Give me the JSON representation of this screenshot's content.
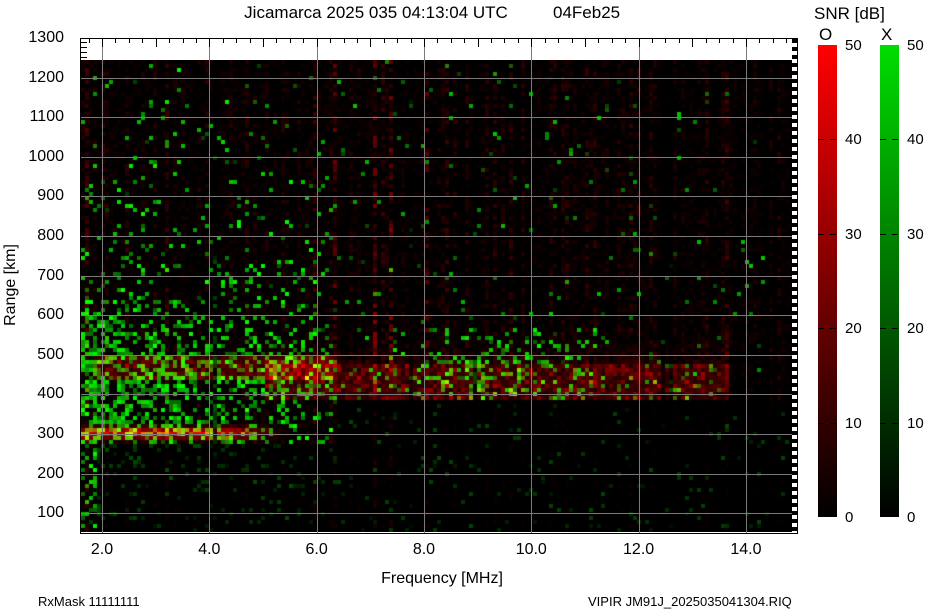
{
  "title": {
    "main": "Jicamarca 2025 035 04:13:04 UTC",
    "date": "04Feb25"
  },
  "footer": {
    "left": "RxMask 11111111",
    "right": "VIPIR  JM91J_2025035041304.RIQ"
  },
  "axes": {
    "x_label": "Frequency [MHz]",
    "y_label": "Range [km]",
    "x_ticks": [
      {
        "label": "2.0",
        "mhz": 2.0
      },
      {
        "label": "4.0",
        "mhz": 4.0
      },
      {
        "label": "6.0",
        "mhz": 6.0
      },
      {
        "label": "8.0",
        "mhz": 8.0
      },
      {
        "label": "10.0",
        "mhz": 10.0
      },
      {
        "label": "12.0",
        "mhz": 12.0
      },
      {
        "label": "14.0",
        "mhz": 14.0
      }
    ],
    "y_ticks": [
      {
        "label": "1300",
        "km": 1300
      },
      {
        "label": "1200",
        "km": 1200
      },
      {
        "label": "1100",
        "km": 1100
      },
      {
        "label": "1000",
        "km": 1000
      },
      {
        "label": "900",
        "km": 900
      },
      {
        "label": "800",
        "km": 800
      },
      {
        "label": "700",
        "km": 700
      },
      {
        "label": "600",
        "km": 600
      },
      {
        "label": "500",
        "km": 500
      },
      {
        "label": "400",
        "km": 400
      },
      {
        "label": "300",
        "km": 300
      },
      {
        "label": "200",
        "km": 200
      },
      {
        "label": "100",
        "km": 100
      }
    ]
  },
  "colorbar": {
    "title": "SNR [dB]",
    "range": [
      0,
      50
    ],
    "ticks": [
      {
        "label": "50",
        "value": 50
      },
      {
        "label": "40",
        "value": 40
      },
      {
        "label": "30",
        "value": 30
      },
      {
        "label": "20",
        "value": 20
      },
      {
        "label": "10",
        "value": 10
      },
      {
        "label": "0",
        "value": 0
      }
    ],
    "bars": [
      {
        "label": "O",
        "top_color": "#ff0000",
        "bottom_color": "#000000"
      },
      {
        "label": "X",
        "top_color": "#00dd00",
        "bottom_color": "#000000"
      }
    ]
  },
  "chart_data": {
    "type": "heatmap",
    "title": "Jicamarca ionogram, day 2025-035 04:13:04 UTC (04Feb25)",
    "xlabel": "Frequency [MHz]",
    "ylabel": "Range [km]",
    "x_range_mhz": [
      1.6,
      15.0
    ],
    "y_range_km": [
      50,
      1300
    ],
    "max_data_range_km": 1244,
    "grid": true,
    "background": "#000000",
    "value_label": "SNR [dB]",
    "value_range_db": [
      0,
      50
    ],
    "polarizations": {
      "O_mode_color": "red",
      "X_mode_color": "green"
    },
    "features": [
      {
        "id": "o_trace",
        "desc": "saturated O-mode F-layer bottom trace ~300 km",
        "kind": "trace",
        "f_mhz": [
          1.61,
          5.4
        ],
        "fade_from_mhz": 4.4,
        "center_km": 300,
        "width_km": 14,
        "peak": 255
      },
      {
        "id": "red_layer2",
        "desc": "second red echo layer 435-495 km at low freq",
        "kind": "band",
        "f_mhz": [
          1.8,
          6.3
        ],
        "range_km": [
          435,
          495
        ],
        "amp": 150
      },
      {
        "id": "spread_band",
        "desc": "spread-F red band 390-470 km, 5-13.7 MHz, 15-35 dB",
        "kind": "band",
        "f_mhz": [
          5.0,
          13.7
        ],
        "range_km": [
          388,
          472
        ],
        "amp": 170,
        "green_speck_density": 0.07
      },
      {
        "id": "green_cloud",
        "desc": "dense green X-mode coherent scatter cloud at low frequencies",
        "kind": "cloud",
        "f_mhz": [
          1.61,
          6.3
        ],
        "center_km": 430,
        "sigma_km": 170,
        "density": 0.5
      },
      {
        "id": "left_edge_green",
        "desc": "green column hugging low-frequency edge",
        "kind": "column",
        "f_mhz": [
          1.61,
          2.0
        ],
        "range_km": [
          80,
          620
        ],
        "density": 0.3
      },
      {
        "id": "green_cluster",
        "desc": "green scatter cluster 390-560 km near 9-10 MHz",
        "kind": "cluster",
        "f_mhz": [
          7.3,
          11.2
        ],
        "range_km": [
          385,
          565
        ],
        "center_mhz": 9.4,
        "sigma_mhz": 1.1,
        "center_km": 470,
        "sigma_km": 70,
        "base_density": 0.1,
        "peak_density": 0.32
      },
      {
        "id": "green_speckle",
        "desc": "sparse green speckle over whole ionogram",
        "kind": "speckle",
        "base_density": 0.012
      },
      {
        "id": "rfi_stripes",
        "desc": "faint dark-red RFI vertical striping over whole band",
        "kind": "noise",
        "amp": 45
      }
    ]
  }
}
